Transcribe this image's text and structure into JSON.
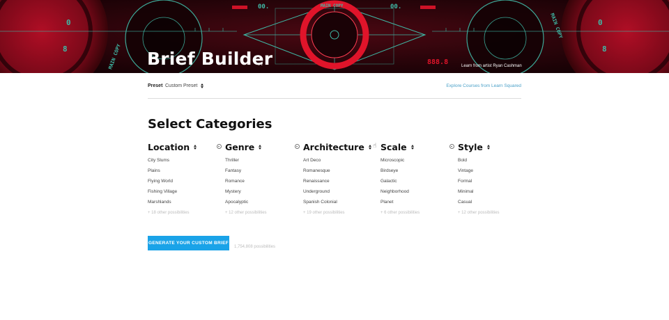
{
  "banner": {
    "title": "Brief Builder",
    "dots": "..",
    "credit": "Learn from artist Ryan Cashman",
    "art_labels": [
      "MAIN COPY",
      "00.",
      "MAIN COPY",
      "MAIN COPY",
      "MAIN COPY",
      "0",
      "8",
      "0",
      "8",
      "888.8"
    ]
  },
  "preset": {
    "label": "Preset",
    "value": "Custom Preset",
    "explore_link": "Explore Courses from Learn Squared"
  },
  "section_title": "Select Categories",
  "categories": [
    {
      "name": "Location",
      "items": [
        "City Slums",
        "Plains",
        "Flying World",
        "Fishing Village",
        "Marshlands"
      ],
      "more": "+ 18 other possibilities"
    },
    {
      "name": "Genre",
      "items": [
        "Thriller",
        "Fantasy",
        "Romance",
        "Mystery",
        "Apocalyptic"
      ],
      "more": "+ 12 other possibilities"
    },
    {
      "name": "Architecture",
      "items": [
        "Art Deco",
        "Romanesque",
        "Renaissance",
        "Underground",
        "Spanish Colonial"
      ],
      "more": "+ 19 other possibilities"
    },
    {
      "name": "Scale",
      "items": [
        "Microscopic",
        "Birdseye",
        "Galactic",
        "Neighborhood",
        "Planet"
      ],
      "more": "+ 6 other possibilities"
    },
    {
      "name": "Style",
      "items": [
        "Bold",
        "Vintage",
        "Formal",
        "Minimal",
        "Casual"
      ],
      "more": "+ 12 other possibilities"
    }
  ],
  "cta": {
    "label": "GENERATE YOUR CUSTOM BRIEF",
    "possibilities": "1,754,808 possibilities"
  },
  "colors": {
    "accent": "#1aa3e8",
    "link": "#4aa0c8",
    "banner_red": "#e0142a",
    "banner_teal": "#3fb9a6"
  },
  "icons": {
    "sort": "sort-arrows-icon",
    "lock": "lock-toggle-icon",
    "hand": "hand-pointer-icon"
  }
}
